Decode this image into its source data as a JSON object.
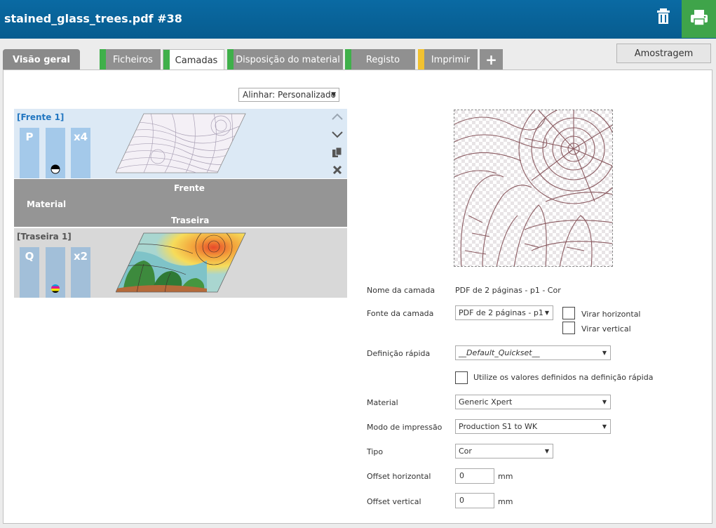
{
  "header": {
    "title": "stained_glass_trees.pdf #38"
  },
  "tabs": [
    {
      "label": "Visão geral",
      "bar_color": ""
    },
    {
      "label": "Ficheiros",
      "bar_color": "#3fb04a"
    },
    {
      "label": "Camadas",
      "bar_color": "#3fb04a"
    },
    {
      "label": "Disposição do material",
      "bar_color": "#3fb04a"
    },
    {
      "label": "Registo",
      "bar_color": "#3fb04a"
    },
    {
      "label": "Imprimir",
      "bar_color": "#f2c230"
    },
    {
      "label": "+",
      "bar_color": ""
    }
  ],
  "sample_button": "Amostragem",
  "align_select": "Alinhar: Personalizado",
  "layers": {
    "front": {
      "label": "[Frente 1]",
      "chip1": "P",
      "chip3": "x4"
    },
    "material": {
      "front": "Frente",
      "label": "Material",
      "back": "Traseira"
    },
    "back": {
      "label": "[Traseira 1]",
      "chip1": "Q",
      "chip3": "x2"
    }
  },
  "form": {
    "layer_name_label": "Nome da camada",
    "layer_name_value": "PDF de 2 páginas - p1 - Cor",
    "layer_source_label": "Fonte da camada",
    "layer_source_value": "PDF de 2 páginas - p1",
    "flip_h": "Virar horizontal",
    "flip_v": "Virar vertical",
    "quickset_label": "Definição rápida",
    "quickset_value": "__Default_Quickset__",
    "use_quickset": "Utilize os valores definidos na definição rápida",
    "material_label": "Material",
    "material_value": "Generic Xpert",
    "print_mode_label": "Modo de impressão",
    "print_mode_value": "Production S1 to WK",
    "type_label": "Tipo",
    "type_value": "Cor",
    "offset_h_label": "Offset horizontal",
    "offset_h_value": "0",
    "offset_v_label": "Offset vertical",
    "offset_v_value": "0",
    "unit": "mm"
  },
  "colors": {
    "header": "#0a6aa3",
    "print_green": "#3fa44a",
    "tab_grey": "#909090"
  }
}
